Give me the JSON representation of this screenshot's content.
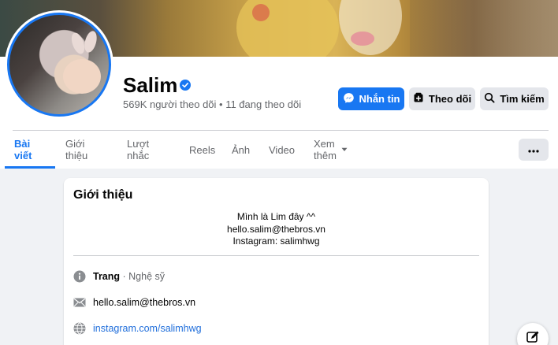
{
  "profile": {
    "name": "Salim",
    "stats": "569K người theo dõi • 11 đang theo dõi"
  },
  "actions": {
    "message": "Nhắn tin",
    "follow": "Theo dõi",
    "search": "Tìm kiếm"
  },
  "tabs": [
    {
      "label": "Bài viết"
    },
    {
      "label": "Giới thiệu"
    },
    {
      "label": "Lượt nhắc"
    },
    {
      "label": "Reels"
    },
    {
      "label": "Ảnh"
    },
    {
      "label": "Video"
    },
    {
      "label": "Xem thêm"
    }
  ],
  "intro": {
    "title": "Giới thiệu",
    "bio": [
      "Mình là Lim đây ^^",
      "hello.salim@thebros.vn",
      "Instagram: salimhwg"
    ],
    "category_label": "Trang",
    "category_sep": " · ",
    "category": "Nghệ sỹ",
    "email": "hello.salim@thebros.vn",
    "website": "instagram.com/salimhwg"
  },
  "colors": {
    "accent": "#1877f2",
    "link": "#216fdb",
    "muted": "#65676b",
    "background": "#f0f2f5"
  },
  "icons": {
    "verified": "verified-badge-icon",
    "messenger": "messenger-icon",
    "follow": "follow-icon",
    "search": "search-icon",
    "dropdown": "caret-down-icon",
    "more": "more-dots-icon",
    "info": "info-icon",
    "email": "envelope-icon",
    "web": "globe-icon",
    "edit": "edit-icon"
  }
}
